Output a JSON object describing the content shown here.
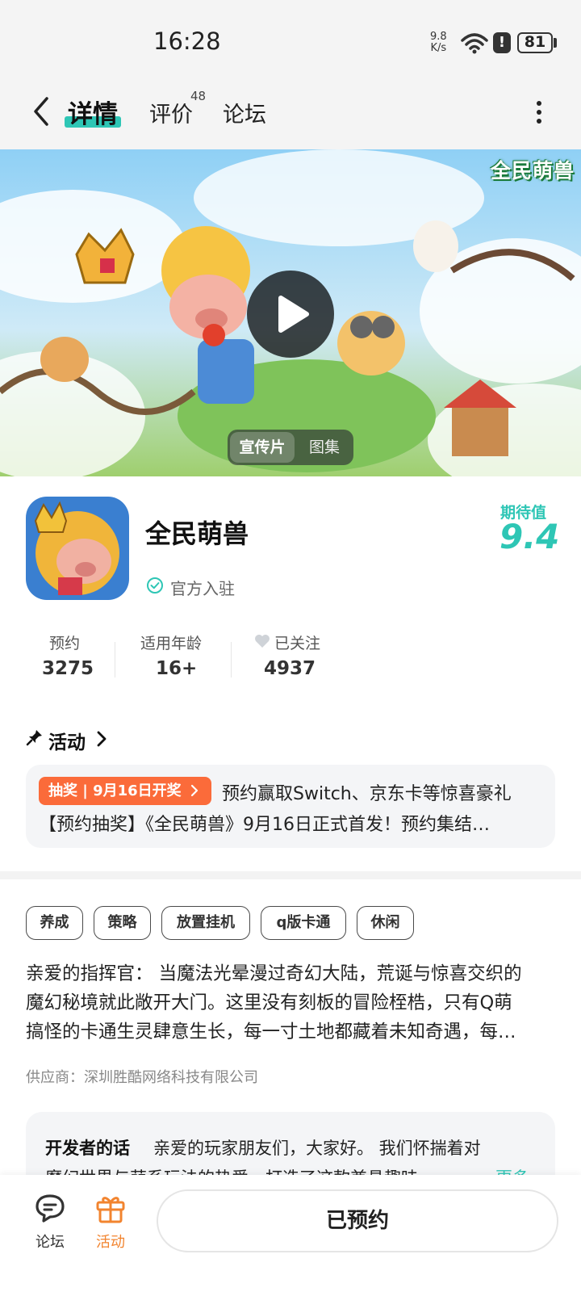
{
  "status_bar": {
    "time": "16:28",
    "net_speed_value": "9.8",
    "net_speed_unit": "K/s",
    "battery": "81"
  },
  "nav": {
    "tabs": [
      {
        "label": "详情"
      },
      {
        "label": "评价"
      },
      {
        "label": "论坛"
      }
    ],
    "review_count": "48",
    "active_tab": "详情"
  },
  "banner": {
    "segments": [
      "宣传片",
      "图集"
    ],
    "logo_text": "全民萌兽"
  },
  "app": {
    "name": "全民萌兽",
    "official_label": "官方入驻",
    "expect_label": "期待值",
    "expect_value": "9.4",
    "stats": [
      {
        "label": "预约",
        "value": "3275"
      },
      {
        "label": "适用年龄",
        "value": "16+"
      },
      {
        "label": "已关注",
        "value": "4937"
      }
    ]
  },
  "activity": {
    "title": "活动",
    "badge": "抽奖 | 9月16日开奖",
    "line1": "预约赢取Switch、京东卡等惊喜豪礼",
    "line2": "【预约抽奖】《全民萌兽》9月16日正式首发！预约集结…"
  },
  "tags": [
    "养成",
    "策略",
    "放置挂机",
    "q版卡通",
    "休闲"
  ],
  "description": {
    "lines": [
      "亲爱的指挥官： 当魔法光晕漫过奇幻大陆，荒诞与惊喜交织的",
      "魔幻秘境就此敞开大门。这里没有刻板的冒险桎梏，只有Q萌",
      "搞怪的卡通生灵肆意生长，每一寸土地都藏着未知奇遇，每…"
    ],
    "supplier": "供应商：深圳胜酷网络科技有限公司"
  },
  "developer": {
    "title": "开发者的话",
    "line1": "亲爱的玩家朋友们，大家好。 我们怀揣着对",
    "line2": "魔幻世界与萌系玩法的热爱，打造了这款兼具趣味…",
    "more": "更多"
  },
  "bottom_bar": {
    "forum_label": "论坛",
    "activity_label": "活动",
    "reserved_label": "已预约"
  },
  "colors": {
    "accent": "#2ec6b5",
    "badge_orange": "#fb6b3a",
    "activity_orange": "#f2842f"
  }
}
